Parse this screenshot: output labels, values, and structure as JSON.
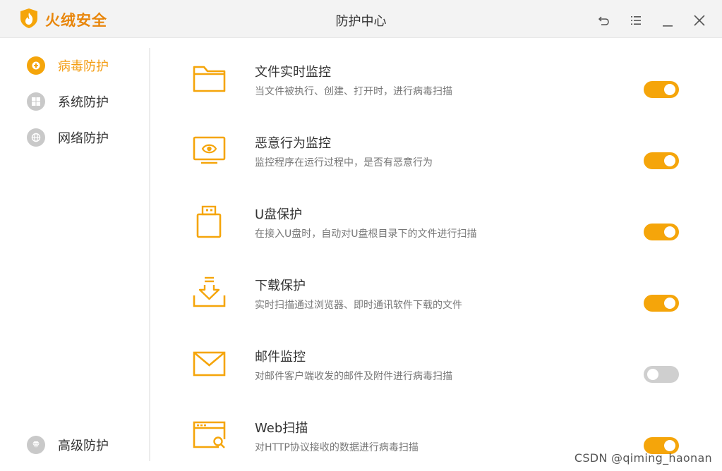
{
  "app": {
    "brand": "火绒安全",
    "window_title": "防护中心",
    "accent_color": "#f5a50a"
  },
  "window_controls": [
    {
      "name": "back-icon"
    },
    {
      "name": "menu-icon"
    },
    {
      "name": "minimize-icon"
    },
    {
      "name": "close-icon"
    }
  ],
  "sidebar": {
    "items": [
      {
        "label": "病毒防护",
        "icon": "virus-shield-icon",
        "active": true
      },
      {
        "label": "系统防护",
        "icon": "windows-icon",
        "active": false
      },
      {
        "label": "网络防护",
        "icon": "globe-icon",
        "active": false
      }
    ],
    "bottom_item": {
      "label": "高级防护",
      "icon": "diamond-icon",
      "active": false
    }
  },
  "protections": [
    {
      "title": "文件实时监控",
      "desc": "当文件被执行、创建、打开时，进行病毒扫描",
      "icon": "folder-icon",
      "enabled": true
    },
    {
      "title": "恶意行为监控",
      "desc": "监控程序在运行过程中，是否有恶意行为",
      "icon": "monitor-eye-icon",
      "enabled": true
    },
    {
      "title": "U盘保护",
      "desc": "在接入U盘时，自动对U盘根目录下的文件进行扫描",
      "icon": "usb-drive-icon",
      "enabled": true
    },
    {
      "title": "下载保护",
      "desc": "实时扫描通过浏览器、即时通讯软件下载的文件",
      "icon": "download-icon",
      "enabled": true
    },
    {
      "title": "邮件监控",
      "desc": "对邮件客户端收发的邮件及附件进行病毒扫描",
      "icon": "mail-icon",
      "enabled": false
    },
    {
      "title": "Web扫描",
      "desc": "对HTTP协议接收的数据进行病毒扫描",
      "icon": "web-scan-icon",
      "enabled": true
    }
  ],
  "watermark": "CSDN @qiming_haonan"
}
